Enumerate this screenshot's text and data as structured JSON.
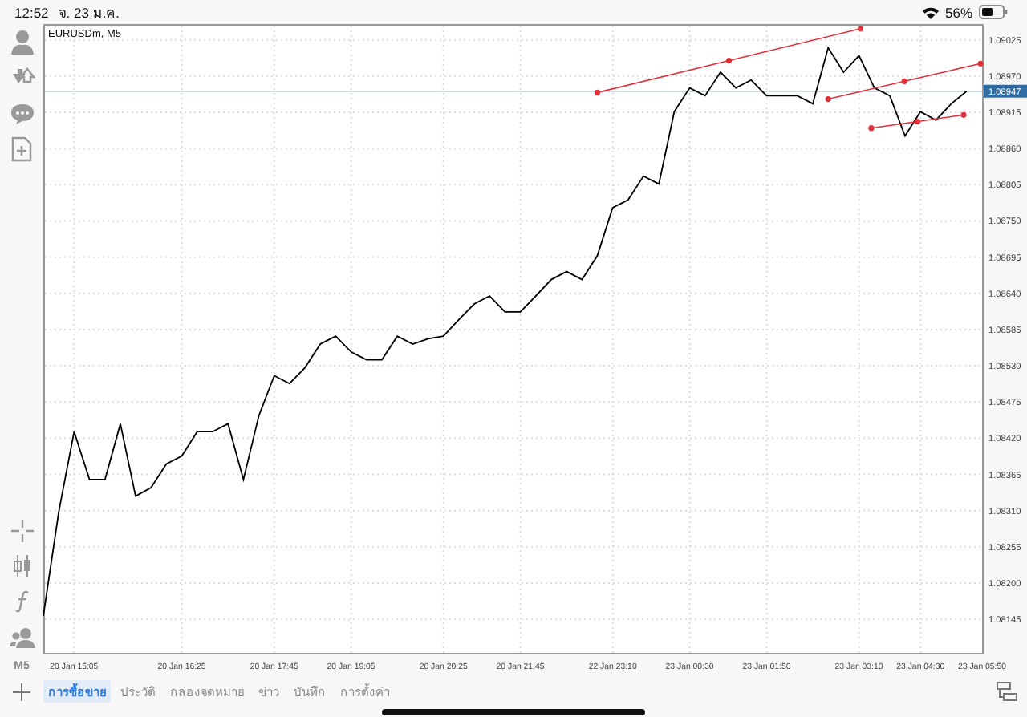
{
  "status_bar": {
    "time": "12:52",
    "date": "จ. 23 ม.ค.",
    "battery": "56%"
  },
  "chart": {
    "symbol": "EURUSDm, M5",
    "chart_data": {
      "type": "line",
      "grid": true,
      "ref_lines": [
        {
          "axis": "y",
          "value": 1.08947,
          "label": "1.08947",
          "color": "#9ab8c8"
        }
      ],
      "categories": [
        null,
        null,
        "20 Jan 15:05",
        null,
        null,
        null,
        null,
        null,
        null,
        "20 Jan 16:25",
        null,
        null,
        null,
        null,
        null,
        "20 Jan 17:45",
        null,
        null,
        null,
        null,
        "20 Jan 19:05",
        null,
        null,
        null,
        null,
        null,
        "20 Jan 20:25",
        null,
        null,
        null,
        null,
        "20 Jan 21:45",
        null,
        null,
        null,
        null,
        null,
        "22 Jan 23:10",
        null,
        null,
        null,
        null,
        "23 Jan 00:30",
        null,
        null,
        null,
        null,
        "23 Jan 01:50",
        null,
        null,
        null,
        null,
        null,
        "23 Jan 03:10",
        null,
        null,
        null,
        "23 Jan 04:30",
        null,
        null,
        null,
        "23 Jan 05:50"
      ],
      "series": [
        {
          "color": "#000000",
          "values": [
            1.0815,
            1.08308,
            1.0843,
            1.08357,
            1.08357,
            1.08442,
            1.08332,
            1.08345,
            1.08381,
            1.08393,
            1.0843,
            1.0843,
            1.08442,
            1.08357,
            1.08454,
            1.08515,
            1.08503,
            1.08527,
            1.08563,
            1.08575,
            1.08551,
            1.08539,
            1.08539,
            1.08575,
            1.08563,
            1.08571,
            1.08575,
            1.086,
            1.08624,
            1.08636,
            1.08612,
            1.08612,
            1.08636,
            1.08661,
            1.08673,
            1.08661,
            1.08697,
            1.0877,
            1.08782,
            1.08818,
            1.08806,
            1.08916,
            1.08952,
            1.0894,
            1.08976,
            1.08952,
            1.08964,
            1.0894,
            1.0894,
            1.0894,
            1.08928,
            1.09013,
            1.08976,
            1.09001,
            1.08952,
            1.0894,
            1.08879,
            1.08916,
            1.08903,
            1.08928,
            1.08947,
            null
          ]
        }
      ],
      "ylim": [
        1.08094,
        1.09049
      ],
      "yticks": [
        {
          "value": 1.09025,
          "label": "1.09025"
        },
        {
          "value": 1.0897,
          "label": "1.08970"
        },
        {
          "value": 1.08915,
          "label": "1.08915"
        },
        {
          "value": 1.0886,
          "label": "1.08860"
        },
        {
          "value": 1.08805,
          "label": "1.08805"
        },
        {
          "value": 1.0875,
          "label": "1.08750"
        },
        {
          "value": 1.08695,
          "label": "1.08695"
        },
        {
          "value": 1.0864,
          "label": "1.08640"
        },
        {
          "value": 1.08585,
          "label": "1.08585"
        },
        {
          "value": 1.0853,
          "label": "1.08530"
        },
        {
          "value": 1.08475,
          "label": "1.08475"
        },
        {
          "value": 1.0842,
          "label": "1.08420"
        },
        {
          "value": 1.08365,
          "label": "1.08365"
        },
        {
          "value": 1.0831,
          "label": "1.08310"
        },
        {
          "value": 1.08255,
          "label": "1.08255"
        },
        {
          "value": 1.082,
          "label": "1.08200"
        },
        {
          "value": 1.08145,
          "label": "1.08145"
        }
      ]
    }
  },
  "left_toolbar": {
    "timeframe": "M5"
  },
  "tabs": [
    {
      "label": "การซื้อขาย",
      "selected": true
    },
    {
      "label": "ประวัติ",
      "selected": false
    },
    {
      "label": "กล่องจดหมาย",
      "selected": false
    },
    {
      "label": "ข่าว",
      "selected": false
    },
    {
      "label": "บันทึก",
      "selected": false
    },
    {
      "label": "การตั้งค่า",
      "selected": false
    }
  ]
}
